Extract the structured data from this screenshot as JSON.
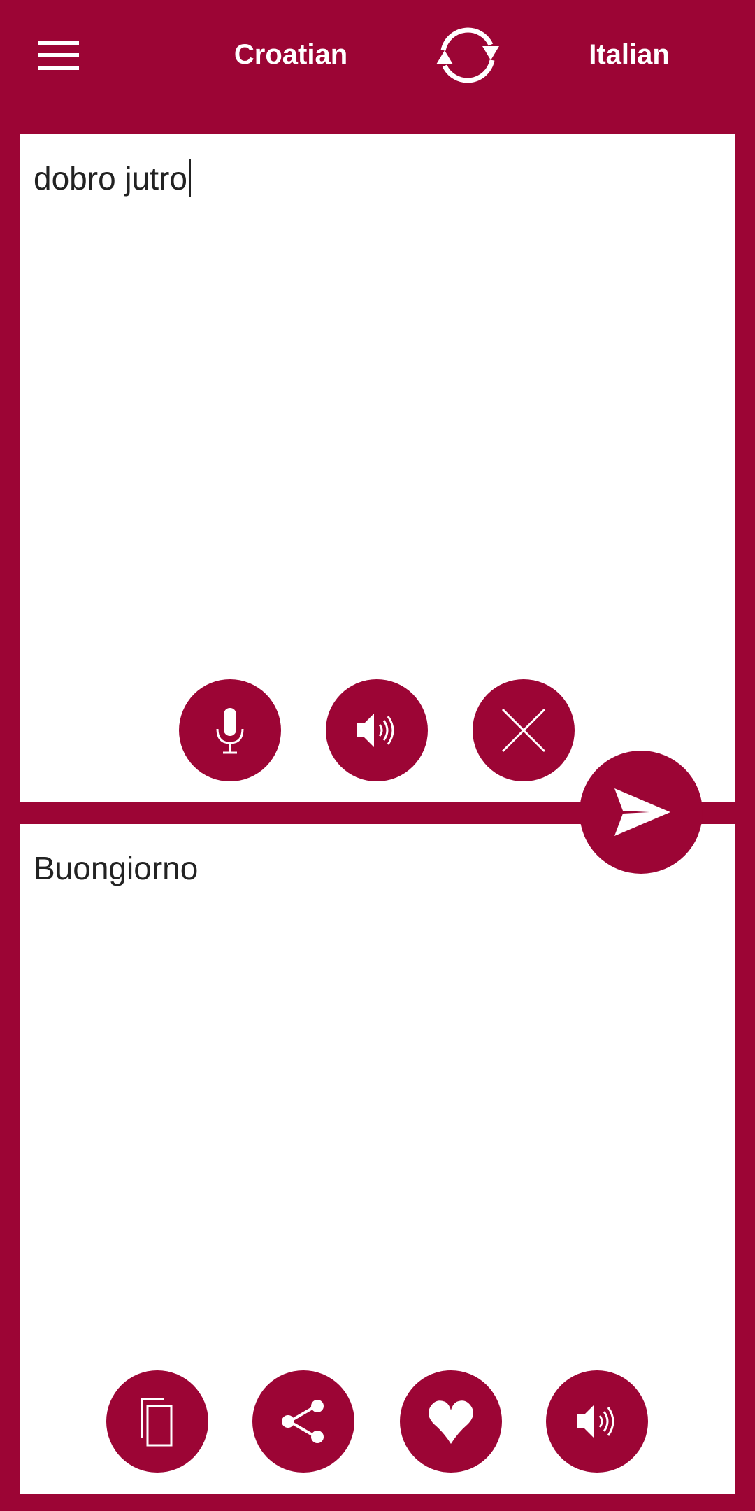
{
  "header": {
    "menu_icon": "hamburger-menu-icon",
    "source_language": "Croatian",
    "target_language": "Italian",
    "swap_icon": "swap-arrows-icon"
  },
  "input": {
    "text": "dobro jutro",
    "buttons": [
      "microphone-icon",
      "speaker-icon",
      "close-icon"
    ]
  },
  "send_icon": "send-paper-plane-icon",
  "output": {
    "text": "Buongiorno",
    "buttons": [
      "copy-icon",
      "share-icon",
      "heart-icon",
      "speaker-icon"
    ]
  },
  "colors": {
    "accent": "#9c0535",
    "background": "#ffffff",
    "text": "#222222"
  }
}
